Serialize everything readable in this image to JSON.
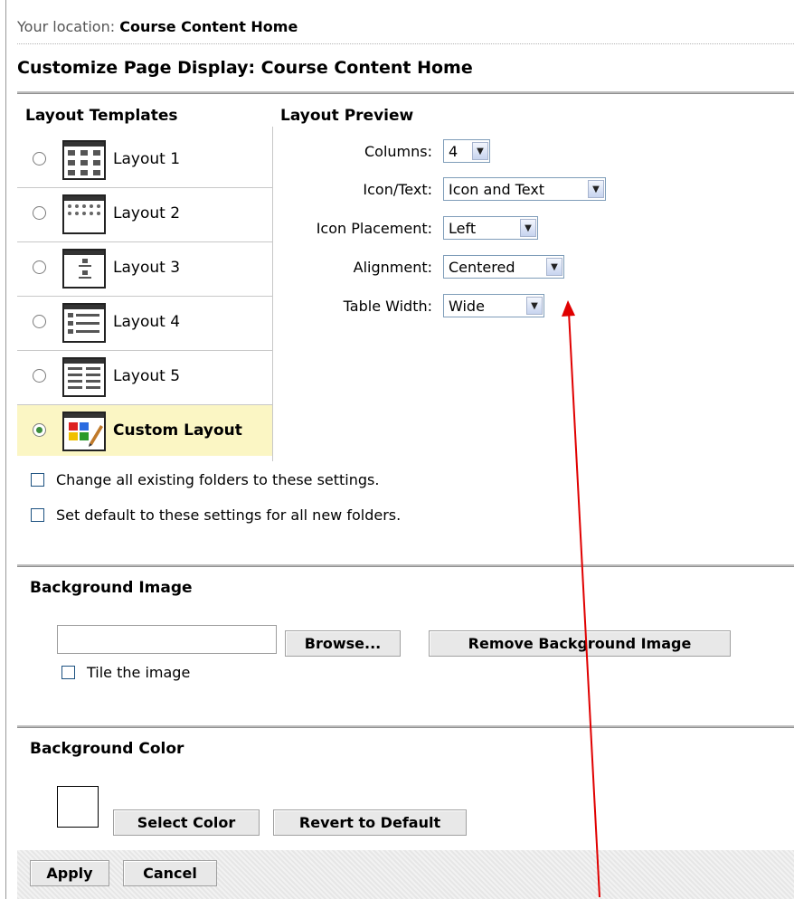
{
  "location": {
    "prefix": "Your location:",
    "name": "Course Content Home"
  },
  "page_title": "Customize Page Display: Course Content Home",
  "layout_templates": {
    "heading": "Layout Templates",
    "items": [
      {
        "label": "Layout 1",
        "selected": false
      },
      {
        "label": "Layout 2",
        "selected": false
      },
      {
        "label": "Layout 3",
        "selected": false
      },
      {
        "label": "Layout 4",
        "selected": false
      },
      {
        "label": "Layout 5",
        "selected": false
      },
      {
        "label": "Custom Layout",
        "selected": true
      }
    ]
  },
  "layout_preview": {
    "heading": "Layout Preview",
    "fields": [
      {
        "label": "Columns:",
        "value": "4"
      },
      {
        "label": "Icon/Text:",
        "value": "Icon and Text"
      },
      {
        "label": "Icon Placement:",
        "value": "Left"
      },
      {
        "label": "Alignment:",
        "value": "Centered"
      },
      {
        "label": "Table Width:",
        "value": "Wide"
      }
    ]
  },
  "options": {
    "change_existing": {
      "label": "Change all existing folders to these settings.",
      "checked": false
    },
    "set_default": {
      "label": "Set default to these settings for all new folders.",
      "checked": false
    }
  },
  "background_image": {
    "heading": "Background Image",
    "file_value": "",
    "browse_label": "Browse...",
    "remove_label": "Remove Background Image",
    "tile_label": "Tile the image",
    "tile_checked": false
  },
  "background_color": {
    "heading": "Background Color",
    "swatch_color": "#ffffff",
    "select_label": "Select Color",
    "revert_label": "Revert to Default"
  },
  "footer": {
    "apply_label": "Apply",
    "cancel_label": "Cancel"
  },
  "annotation": {
    "arrow_color": "#e00000"
  },
  "icons": [
    "layout-1-icon",
    "layout-2-icon",
    "layout-3-icon",
    "layout-4-icon",
    "layout-5-icon",
    "custom-layout-icon",
    "dropdown-arrow-icon"
  ]
}
